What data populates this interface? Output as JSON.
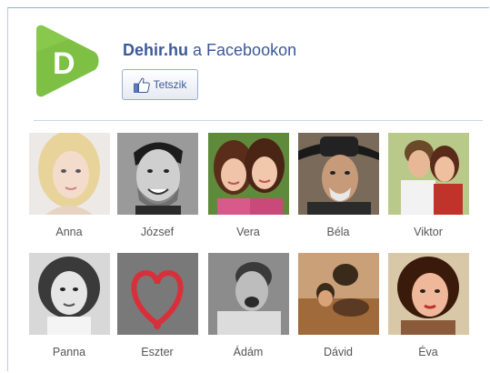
{
  "page": {
    "name": "Dehir.hu",
    "suffix": " a Facebookon",
    "logo_letter": "D"
  },
  "like_button": {
    "label": "Tetszik",
    "icon": "thumbs-up-icon"
  },
  "colors": {
    "brand_green": "#7dc043",
    "facebook_blue": "#3b5998"
  },
  "fans": [
    {
      "name": "Anna"
    },
    {
      "name": "József"
    },
    {
      "name": "Vera"
    },
    {
      "name": "Béla"
    },
    {
      "name": "Viktor"
    },
    {
      "name": "Panna"
    },
    {
      "name": "Eszter"
    },
    {
      "name": "Ádám"
    },
    {
      "name": "Dávid"
    },
    {
      "name": "Éva"
    }
  ]
}
